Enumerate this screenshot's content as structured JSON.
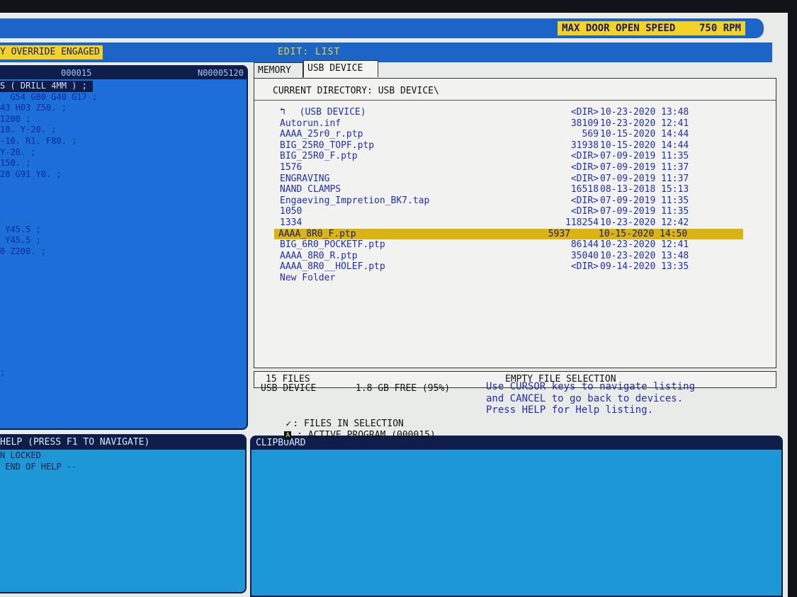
{
  "header": {
    "speed_label": "MAX DOOR OPEN SPEED",
    "speed_value": "750 RPM",
    "override": "Y OVERRIDE ENGAGED",
    "mode": "EDIT: LIST"
  },
  "program_panel": {
    "program_name": "000015",
    "line_number": "N00005120",
    "lines": [
      "S ( DRILL 4MM ) ;",
      "  G54 G80 G40 G17 ;",
      "43 H03 Z50. ;",
      "1200 ;",
      "10. Y-20. ;",
      "-10. R1. F80. ;",
      "Y-20. ;",
      "150. ;",
      "28 G91 Y0. ;",
      "",
      "",
      "",
      "",
      " Y45.5 ;",
      " Y45.5 ;",
      "0 Z200. ;"
    ],
    "last_line": ";"
  },
  "help_panel": {
    "title": "HELP (PRESS F1 TO NAVIGATE)",
    "lines": [
      "",
      "N LOCKED",
      " END OF HELP --"
    ]
  },
  "clipboard": {
    "title": "CLIPBOARD"
  },
  "tabs": [
    {
      "label": "MEMORY"
    },
    {
      "label": "USB DEVICE"
    }
  ],
  "browser": {
    "current_directory": "CURRENT DIRECTORY: USB DEVICE\\",
    "parent_label": "  (USB DEVICE)",
    "files": [
      {
        "name": "Autorun.inf",
        "size": "38109",
        "date": "10-23-2020 12:41"
      },
      {
        "name": "AAAA_25r0_r.ptp",
        "size": "569",
        "date": "10-15-2020 14:44"
      },
      {
        "name": "BIG_25R0_TOPF.ptp",
        "size": "31938",
        "date": "10-15-2020 14:44"
      },
      {
        "name": "BIG_25R0_F.ptp",
        "size": "<DIR>",
        "date": "07-09-2019 11:35"
      },
      {
        "name": "1576",
        "size": "<DIR>",
        "date": "07-09-2019 11:37"
      },
      {
        "name": "ENGRAVING",
        "size": "<DIR>",
        "date": "07-09-2019 11:37"
      },
      {
        "name": "NAND CLAMPS",
        "size": "16518",
        "date": "08-13-2018 15:13"
      },
      {
        "name": "Engaeving_Impretion_BK7.tap",
        "size": "<DIR>",
        "date": "07-09-2019 11:35"
      },
      {
        "name": "1050",
        "size": "<DIR>",
        "date": "07-09-2019 11:35"
      },
      {
        "name": "1334",
        "size": "118254",
        "date": "10-23-2020 12:42"
      },
      {
        "name": "AAAA_8R0_F.ptp",
        "size": "5937",
        "date": "10-15-2020 14:50"
      },
      {
        "name": "BIG_6R0_POCKETF.ptp",
        "size": "86144",
        "date": "10-23-2020 12:41"
      },
      {
        "name": "AAAA_8R0_R.ptp",
        "size": "35040",
        "date": "10-23-2020 13:48"
      },
      {
        "name": "AAAA_8R0__HOLEF.ptp",
        "size": "<DIR>",
        "date": "09-14-2020 13:35"
      },
      {
        "name": "New Folder",
        "size": "",
        "date": ""
      }
    ],
    "parent_size": "<DIR>",
    "parent_date": "10-23-2020 13:48"
  },
  "status": {
    "count": "15 FILES",
    "selection": "EMPTY FILE SELECTION"
  },
  "device_info": {
    "device": "USB DEVICE",
    "free": "1.8 GB FREE (95%)",
    "legend_files": ": FILES IN SELECTION",
    "legend_active": ": ACTIVE PROGRAM (000015)",
    "check_symbol": "✓",
    "active_symbol": "A"
  },
  "hint": "Use CURSOR keys to navigate listing\nand CANCEL to go back to devices.\nPress HELP for Help listing."
}
